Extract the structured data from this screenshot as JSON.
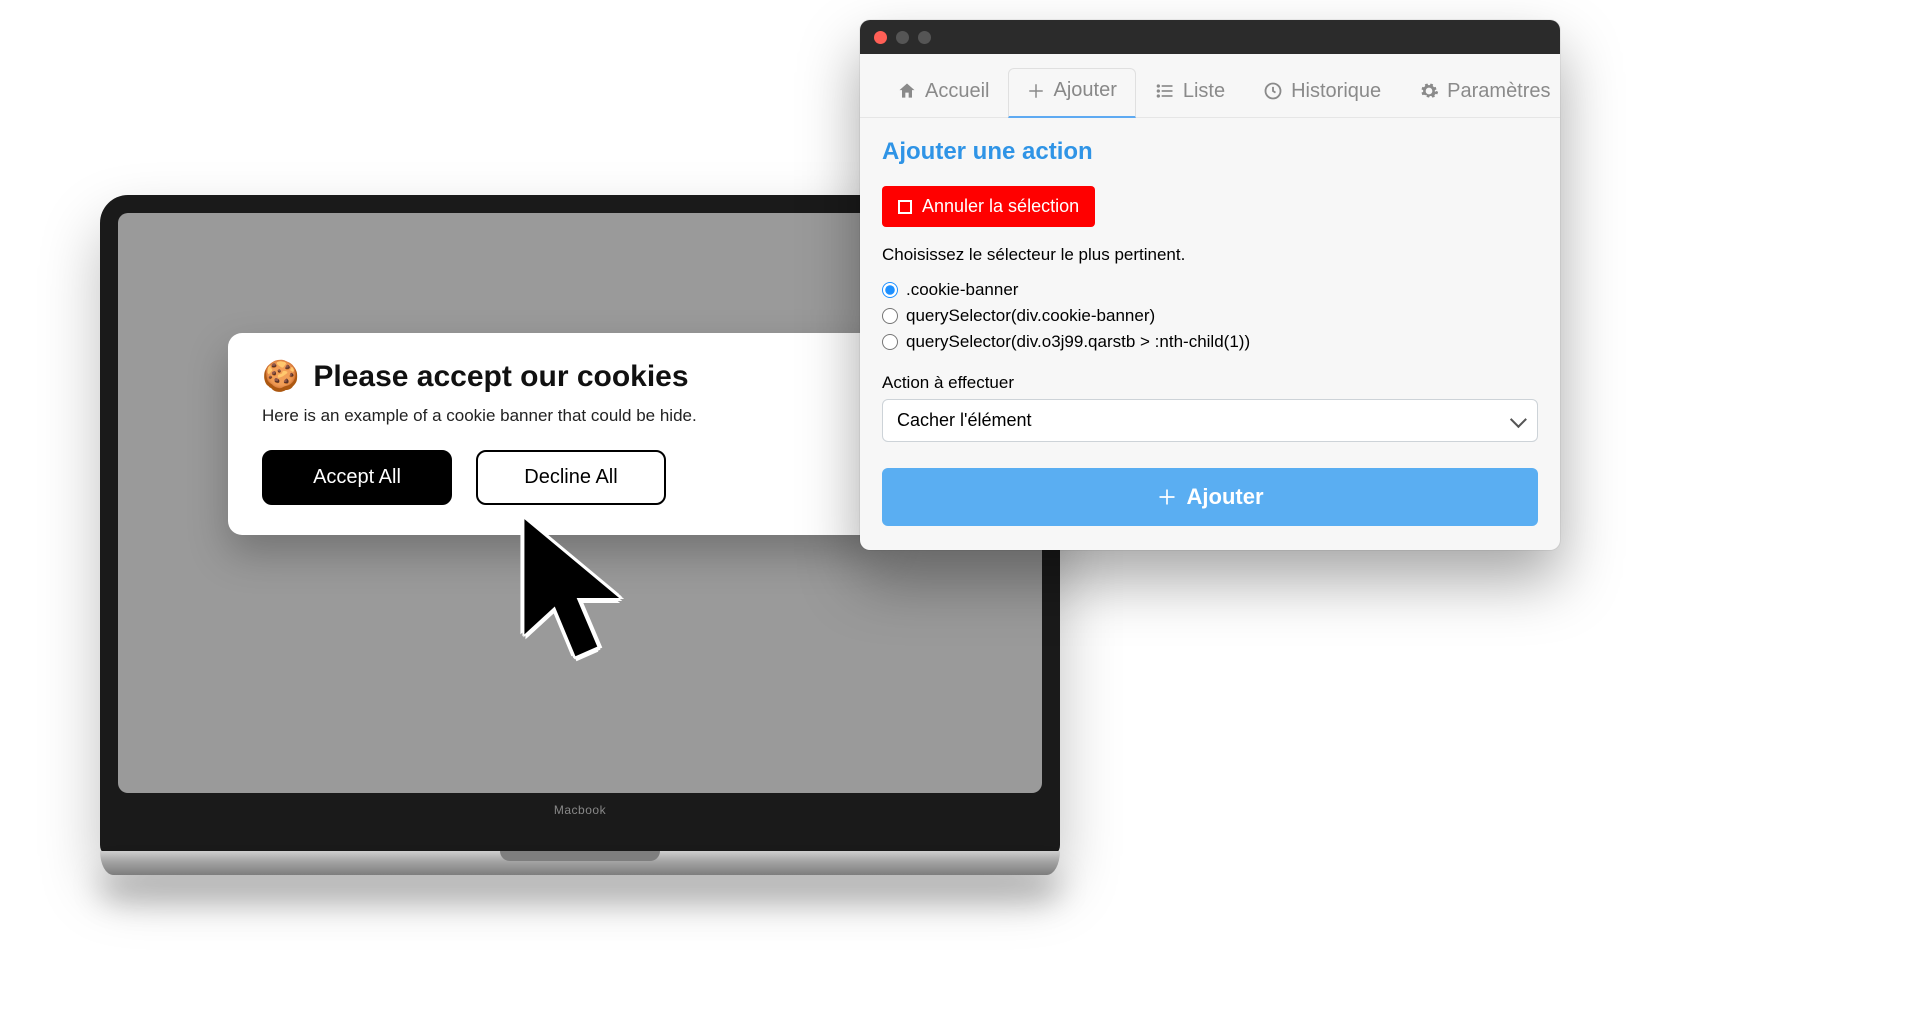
{
  "laptop": {
    "brand": "Macbook",
    "cookie": {
      "emoji": "🍪",
      "title": "Please accept our cookies",
      "description": "Here is an example of a cookie banner that could be hide.",
      "accept": "Accept All",
      "decline": "Decline All"
    }
  },
  "ext": {
    "tabs": {
      "home": "Accueil",
      "add": "Ajouter",
      "list": "Liste",
      "history": "Historique",
      "settings": "Paramètres"
    },
    "heading": "Ajouter une action",
    "cancel_selection": "Annuler la sélection",
    "choose_selector_hint": "Choisissez le sélecteur le plus pertinent.",
    "selectors": {
      "opt1": ".cookie-banner",
      "opt2": "querySelector(div.cookie-banner)",
      "opt3": "querySelector(div.o3j99.qarstb > :nth-child(1))"
    },
    "action_label": "Action à effectuer",
    "action_value": "Cacher l'élément",
    "submit": "Ajouter"
  }
}
